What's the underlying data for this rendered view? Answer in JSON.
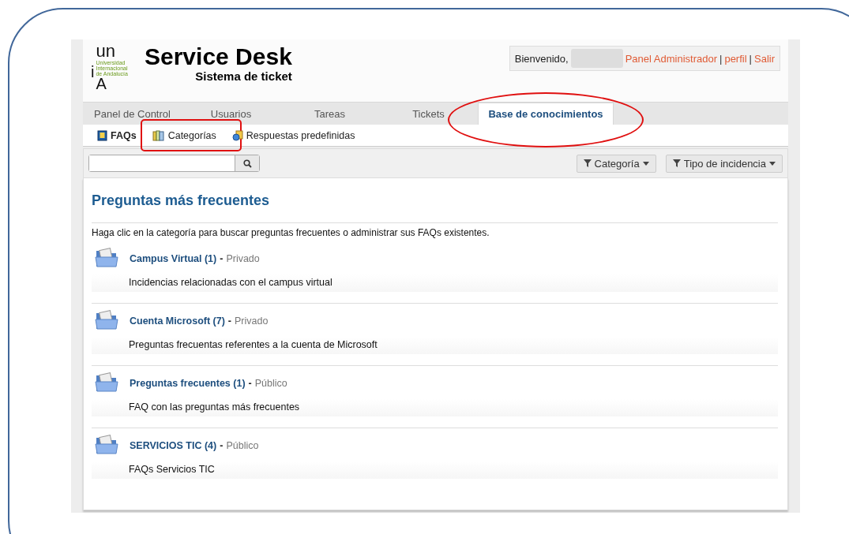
{
  "logo": {
    "top": "un",
    "side": "i",
    "bottom": "A",
    "university": [
      "Universidad",
      "Internacional",
      "de Andalucía"
    ]
  },
  "header": {
    "title": "Service Desk",
    "subtitle": "Sistema de ticket"
  },
  "user_box": {
    "greeting": "Bienvenido,",
    "links": [
      {
        "label": "Panel Administrador"
      },
      {
        "label": "perfil"
      },
      {
        "label": "Salir"
      }
    ],
    "separator": "|"
  },
  "tabs": [
    {
      "label": "Panel de Control",
      "selected": false
    },
    {
      "label": "Usuarios",
      "selected": false
    },
    {
      "label": "Tareas",
      "selected": false
    },
    {
      "label": "Tickets",
      "selected": false
    },
    {
      "label": "Base de conocimientos",
      "selected": true,
      "circled": true
    }
  ],
  "subnav": [
    {
      "label": "FAQs",
      "kind": "faq",
      "selected": true
    },
    {
      "label": "Categorías",
      "kind": "categories",
      "selected": false,
      "boxed": true
    },
    {
      "label": "Respuestas predefinidas",
      "kind": "canned",
      "selected": false
    }
  ],
  "toolbar": {
    "filters": [
      {
        "label": "Categoría"
      },
      {
        "label": "Tipo de incidencia"
      }
    ]
  },
  "content": {
    "heading": "Preguntas más frecuentes",
    "intro": "Haga clic en la categoría para buscar preguntas frecuentes o administrar sus FAQs existentes.",
    "categories": [
      {
        "name": "Campus Virtual (1)",
        "dash": "-",
        "visibility": "Privado",
        "description": "Incidencias relacionadas con el campus virtual"
      },
      {
        "name": "Cuenta Microsoft (7)",
        "dash": "-",
        "visibility": "Privado",
        "description": "Preguntas frecuentas referentes a la cuenta de Microsoft"
      },
      {
        "name": "Preguntas frecuentes (1)",
        "dash": "-",
        "visibility": "Público",
        "description": "FAQ con las preguntas más frecuentes"
      },
      {
        "name": "SERVICIOS TIC (4)",
        "dash": "-",
        "visibility": "Público",
        "description": "FAQs Servicios TIC"
      }
    ]
  }
}
